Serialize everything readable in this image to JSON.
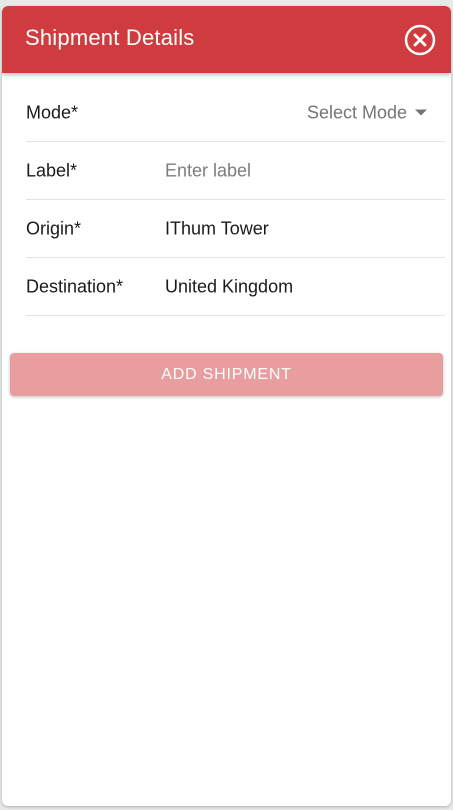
{
  "header": {
    "title": "Shipment Details",
    "close_icon": "close-circle-icon"
  },
  "form": {
    "mode": {
      "label": "Mode*",
      "selected": "Select Mode"
    },
    "label": {
      "label": "Label*",
      "placeholder": "Enter label",
      "value": ""
    },
    "origin": {
      "label": "Origin*",
      "value": "IThum Tower"
    },
    "destination": {
      "label": "Destination*",
      "value": "United Kingdom"
    }
  },
  "actions": {
    "add_label": "ADD SHIPMENT"
  },
  "colors": {
    "header": "#cf3b3e",
    "button_disabled": "#e89d9e"
  }
}
